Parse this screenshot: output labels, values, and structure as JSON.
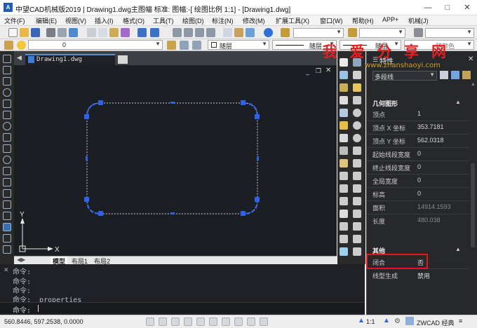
{
  "window": {
    "title": "中望CAD机械版2019 | Drawing1.dwg主图幅  标准: 图幅:-[ 绘图比例 1:1] - [Drawing1.dwg]",
    "app_icon": "A"
  },
  "menu": [
    "文件(F)",
    "编辑(E)",
    "视图(V)",
    "插入(I)",
    "格式(O)",
    "工具(T)",
    "绘图(D)",
    "标注(N)",
    "修改(M)",
    "扩展工具(X)",
    "窗口(W)",
    "帮助(H)",
    "APP+",
    "机械(J)"
  ],
  "layer_bar": {
    "layer_value": "0",
    "color_value": "随层",
    "linetype_value": "随层",
    "lineweight_value": "随层",
    "plotstyle_value": "随颜色"
  },
  "drawing_tab": {
    "label": "Drawing1.dwg"
  },
  "layout_tabs": [
    "模型",
    "布局1",
    "布局2"
  ],
  "ucs": {
    "x_label": "X",
    "y_label": "Y"
  },
  "command_history": [
    "命令:",
    "命令:",
    "命令:",
    "命令:  _properties"
  ],
  "command_prompt": "命令:",
  "properties": {
    "title": "特性",
    "object_type": "多段线",
    "section_geometry": "几何图形",
    "section_misc": "其他",
    "rows": [
      {
        "label": "顶点",
        "value": "1"
      },
      {
        "label": "顶点 X 坐标",
        "value": "353.7181"
      },
      {
        "label": "顶点 Y 坐标",
        "value": "562.0318"
      },
      {
        "label": "起始线段宽度",
        "value": "0"
      },
      {
        "label": "终止线段宽度",
        "value": "0"
      },
      {
        "label": "全局宽度",
        "value": "0"
      },
      {
        "label": "标高",
        "value": "0"
      },
      {
        "label": "面积",
        "value": "14914.1593"
      },
      {
        "label": "长度",
        "value": "480.038"
      }
    ],
    "misc_rows": [
      {
        "label": "闭合",
        "value": "否"
      },
      {
        "label": "线型生成",
        "value": "禁用"
      }
    ]
  },
  "watermark": {
    "text": "我 爱 分 享 网",
    "url": "www.zhanshaoyi.com"
  },
  "status": {
    "coords": "560.8446, 597.2538, 0.0000",
    "scale": "1:1",
    "brand": "ZWCAD 经典"
  },
  "colors": {
    "canvas": "#1b1e23",
    "selection_blue": "#2f62e8",
    "highlight_red": "#e01818"
  }
}
